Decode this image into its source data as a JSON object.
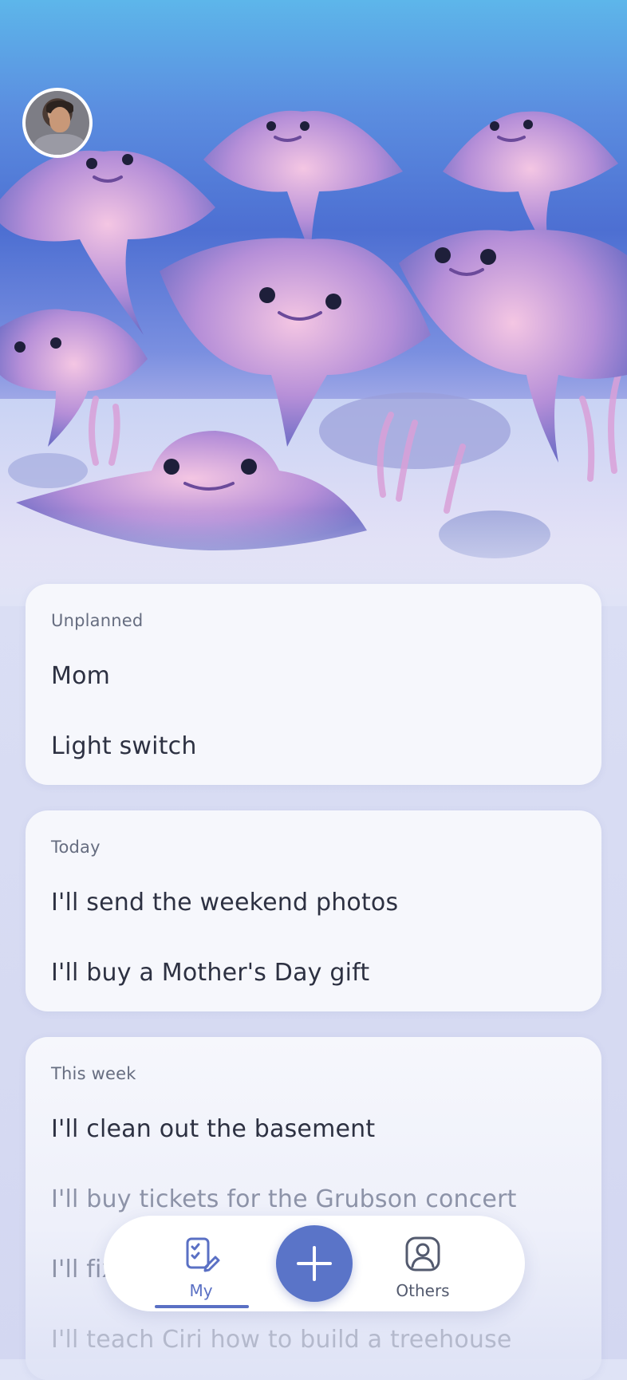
{
  "profile": {
    "avatar_icon": "user-avatar"
  },
  "sections": [
    {
      "title": "Unplanned",
      "items": [
        "Mom",
        "Light switch"
      ]
    },
    {
      "title": "Today",
      "items": [
        "I'll send the weekend photos",
        "I'll buy a Mother's Day gift"
      ]
    },
    {
      "title": "This week",
      "items": [
        "I'll clean out the basement",
        "I'll buy tickets for the Grubson concert",
        "I'll fix",
        "I'll teach Ciri how to build a treehouse"
      ]
    }
  ],
  "tabbar": {
    "my_label": "My",
    "others_label": "Others",
    "my_icon": "clipboard-edit-icon",
    "add_icon": "plus-icon",
    "others_icon": "person-icon",
    "accent": "#5a74c8"
  }
}
